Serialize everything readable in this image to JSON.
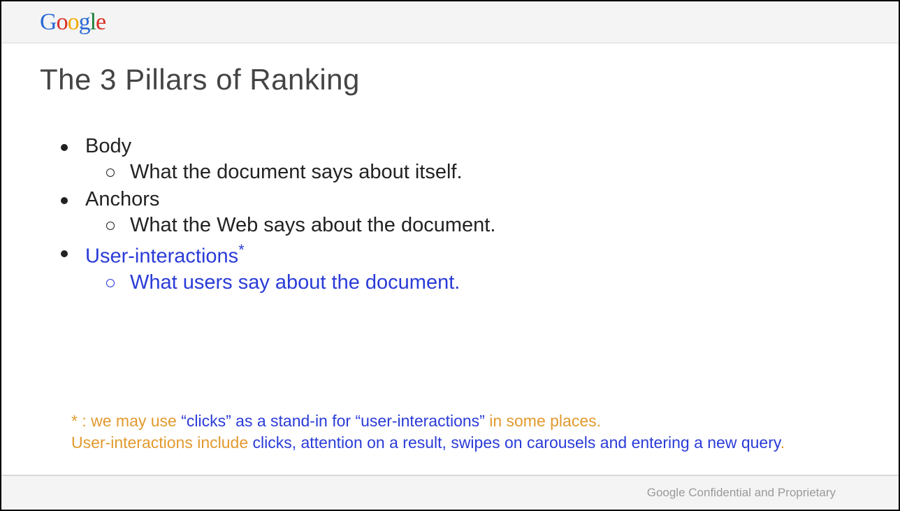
{
  "logo": {
    "g1": "G",
    "o1": "o",
    "o2": "o",
    "g2": "g",
    "l1": "l",
    "e1": "e"
  },
  "slide": {
    "title": "The 3 Pillars of Ranking",
    "pillars": [
      {
        "title": "Body",
        "sub": "What the document says about itself."
      },
      {
        "title": "Anchors",
        "sub": "What the Web says about the document."
      },
      {
        "title": "User-interactions",
        "asterisk": "*",
        "sub": "What users say about the document."
      }
    ],
    "footnote": {
      "p1": "* : we may use ",
      "p2": "“clicks” as a stand-in for “user-interactions”",
      "p3": " in some places.",
      "p4": "User-interactions include ",
      "p5": "clicks, attention on a result, swipes on carousels and entering a new query",
      "p6": "."
    }
  },
  "footer": {
    "text": "Google Confidential and Proprietary"
  }
}
